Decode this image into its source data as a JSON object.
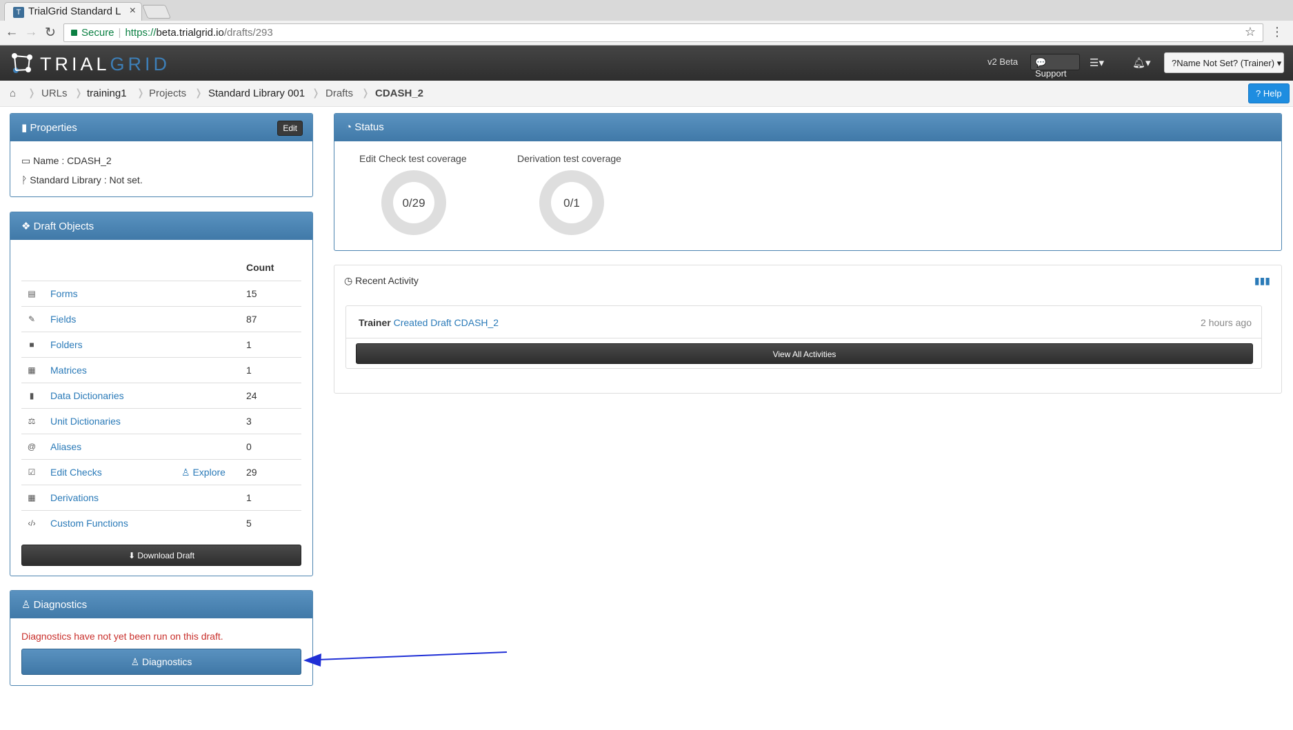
{
  "browser": {
    "tab_title": "TrialGrid Standard L",
    "secure_label": "Secure",
    "url_scheme": "https://",
    "url_host": "beta.trialgrid.io",
    "url_path": "/drafts/293"
  },
  "navbar": {
    "logo_trial": "TRIAL",
    "logo_grid": "GRID",
    "version": "v2 Beta",
    "support_label": "Support",
    "user_label": "?Name Not Set? (Trainer)"
  },
  "breadcrumb": {
    "items": [
      "URLs",
      "training1",
      "Projects",
      "Standard Library 001",
      "Drafts",
      "CDASH_2"
    ],
    "help_label": "Help"
  },
  "properties": {
    "title": "Properties",
    "edit_label": "Edit",
    "name_line": "Name : CDASH_2",
    "library_line": "Standard Library : Not set."
  },
  "draft_objects": {
    "title": "Draft Objects",
    "count_header": "Count",
    "rows": [
      {
        "label": "Forms",
        "count": "15"
      },
      {
        "label": "Fields",
        "count": "87"
      },
      {
        "label": "Folders",
        "count": "1"
      },
      {
        "label": "Matrices",
        "count": "1"
      },
      {
        "label": "Data Dictionaries",
        "count": "24"
      },
      {
        "label": "Unit Dictionaries",
        "count": "3"
      },
      {
        "label": "Aliases",
        "count": "0"
      },
      {
        "label": "Edit Checks",
        "count": "29"
      },
      {
        "label": "Derivations",
        "count": "1"
      },
      {
        "label": "Custom Functions",
        "count": "5"
      }
    ],
    "explore_label": "Explore",
    "download_label": "Download Draft"
  },
  "diagnostics": {
    "title": "Diagnostics",
    "message": "Diagnostics have not yet been run on this draft.",
    "button_label": "Diagnostics"
  },
  "status": {
    "title": "Status",
    "edit_check_title": "Edit Check test coverage",
    "edit_check_value": "0/29",
    "derivation_title": "Derivation test coverage",
    "derivation_value": "0/1"
  },
  "activity": {
    "title": "Recent Activity",
    "user": "Trainer",
    "action": "Created Draft CDASH_2",
    "time": "2 hours ago",
    "view_all_label": "View All Activities"
  },
  "colors": {
    "accent_blue": "#4a86b5",
    "link_blue": "#2a7ab8",
    "error_red": "#c9302c",
    "arrow_blue": "#1f2fd6"
  }
}
